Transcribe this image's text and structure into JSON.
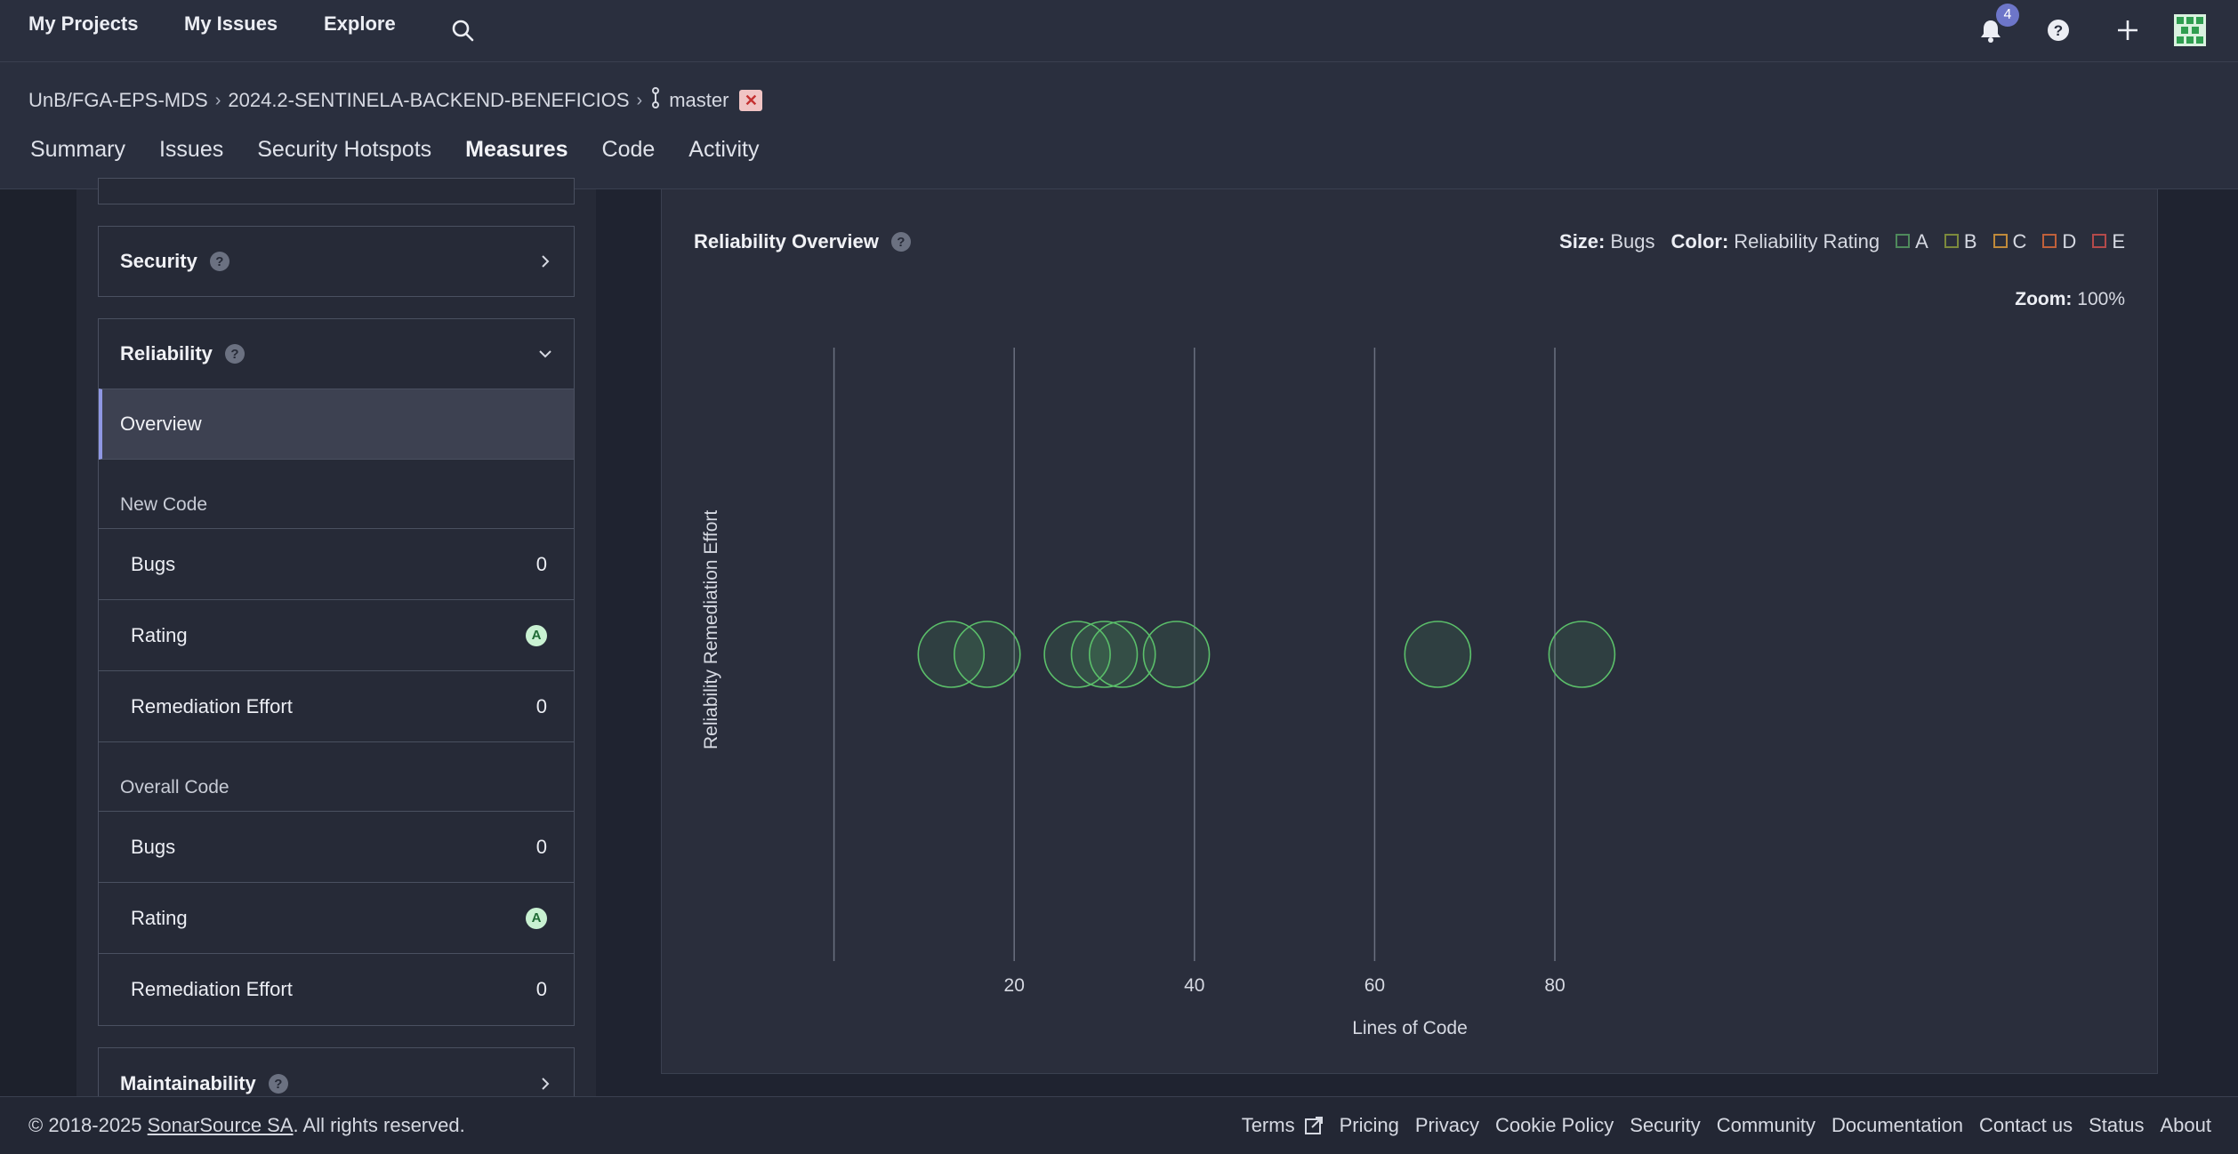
{
  "topnav": {
    "my_projects": "My Projects",
    "my_issues": "My Issues",
    "explore": "Explore",
    "notification_count": "4",
    "icons": [
      "search-icon",
      "bell-icon",
      "help-icon",
      "plus-icon",
      "avatar"
    ]
  },
  "breadcrumb": {
    "org": "UnB/FGA-EPS-MDS",
    "project": "2024.2-SENTINELA-BACKEND-BENEFICIOS",
    "branch": "master",
    "warning": "✕"
  },
  "tabs": [
    "Summary",
    "Issues",
    "Security Hotspots",
    "Measures",
    "Code",
    "Activity"
  ],
  "active_tab": "Measures",
  "sidebar": {
    "security": {
      "title": "Security",
      "help": "?"
    },
    "reliability": {
      "title": "Reliability",
      "help": "?",
      "overview": "Overview",
      "new_code": {
        "label": "New Code",
        "bugs_label": "Bugs",
        "bugs_value": "0",
        "rating_label": "Rating",
        "rating_value": "A",
        "effort_label": "Remediation Effort",
        "effort_value": "0"
      },
      "overall_code": {
        "label": "Overall Code",
        "bugs_label": "Bugs",
        "bugs_value": "0",
        "rating_label": "Rating",
        "rating_value": "A",
        "effort_label": "Remediation Effort",
        "effort_value": "0"
      }
    },
    "maintainability": {
      "title": "Maintainability",
      "help": "?"
    }
  },
  "chart": {
    "title": "Reliability Overview",
    "help": "?",
    "size_label": "Size:",
    "size_value": "Bugs",
    "color_label": "Color:",
    "color_value": "Reliability Rating",
    "legend": [
      {
        "label": "A",
        "color": "#4f8a5c"
      },
      {
        "label": "B",
        "color": "#7c8a3c"
      },
      {
        "label": "C",
        "color": "#c08a3a"
      },
      {
        "label": "D",
        "color": "#c0603a"
      },
      {
        "label": "E",
        "color": "#b44a4a"
      }
    ],
    "zoom_label": "Zoom:",
    "zoom_value": "100%",
    "xlabel": "Lines of Code",
    "ylabel": "Reliability Remediation Effort"
  },
  "chart_data": {
    "type": "scatter",
    "xlabel": "Lines of Code",
    "ylabel": "Reliability Remediation Effort",
    "xlim": [
      0,
      90
    ],
    "x_ticks": [
      20,
      40,
      60,
      80
    ],
    "points": [
      {
        "x": 13,
        "y": 0,
        "rating": "A"
      },
      {
        "x": 17,
        "y": 0,
        "rating": "A"
      },
      {
        "x": 27,
        "y": 0,
        "rating": "A"
      },
      {
        "x": 30,
        "y": 0,
        "rating": "A"
      },
      {
        "x": 32,
        "y": 0,
        "rating": "A"
      },
      {
        "x": 38,
        "y": 0,
        "rating": "A"
      },
      {
        "x": 67,
        "y": 0,
        "rating": "A"
      },
      {
        "x": 83,
        "y": 0,
        "rating": "A"
      }
    ],
    "point_color": "#5bbf6a"
  },
  "footer": {
    "copyright_prefix": "© 2018-2025 ",
    "company": "SonarSource SA",
    "copyright_suffix": ". All rights reserved.",
    "links": [
      "Terms",
      "Pricing",
      "Privacy",
      "Cookie Policy",
      "Security",
      "Community",
      "Documentation",
      "Contact us",
      "Status",
      "About"
    ]
  }
}
